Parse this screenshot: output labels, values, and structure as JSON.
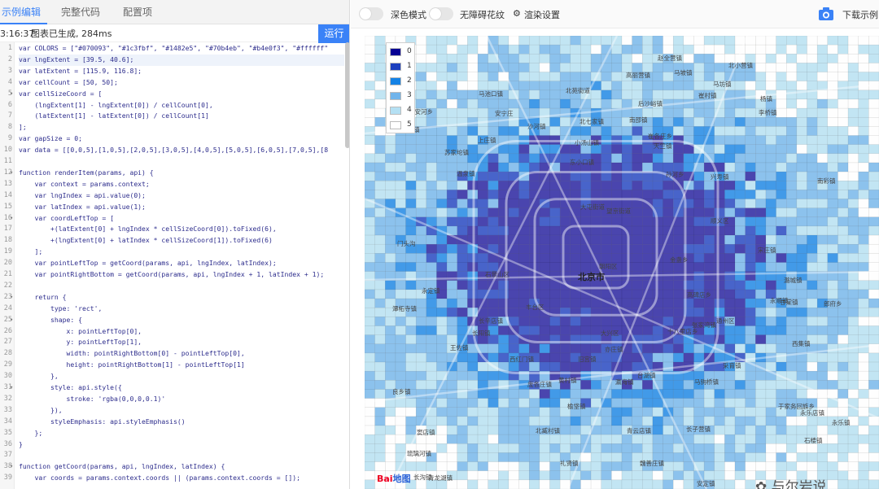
{
  "tabs": [
    "示例编辑",
    "完整代码",
    "配置项"
  ],
  "status": {
    "time": "3:16:37",
    "message": "图表已生成, 284ms"
  },
  "run_label": "运行",
  "code_lines": [
    "var COLORS = [\"#070093\", \"#1c3fbf\", \"#1482e5\", \"#70b4eb\", \"#b4e0f3\", \"#ffffff\"",
    "var lngExtent = [39.5, 40.6];",
    "var latExtent = [115.9, 116.8];",
    "var cellCount = [50, 50];",
    "var cellSizeCoord = [",
    "    (lngExtent[1] - lngExtent[0]) / cellCount[0],",
    "    (latExtent[1] - latExtent[0]) / cellCount[1]",
    "];",
    "var gapSize = 0;",
    "var data = [[0,0,5],[1,0,5],[2,0,5],[3,0,5],[4,0,5],[5,0,5],[6,0,5],[7,0,5],[8",
    "",
    "function renderItem(params, api) {",
    "    var context = params.context;",
    "    var lngIndex = api.value(0);",
    "    var latIndex = api.value(1);",
    "    var coordLeftTop = [",
    "        +(latExtent[0] + lngIndex * cellSizeCoord[0]).toFixed(6),",
    "        +(lngExtent[0] + latIndex * cellSizeCoord[1]).toFixed(6)",
    "    ];",
    "    var pointLeftTop = getCoord(params, api, lngIndex, latIndex);",
    "    var pointRightBottom = getCoord(params, api, lngIndex + 1, latIndex + 1);",
    "",
    "    return {",
    "        type: 'rect',",
    "        shape: {",
    "            x: pointLeftTop[0],",
    "            y: pointLeftTop[1],",
    "            width: pointRightBottom[0] - pointLeftTop[0],",
    "            height: pointRightBottom[1] - pointLeftTop[1]",
    "        },",
    "        style: api.style({",
    "            stroke: 'rgba(0,0,0,0.1)'",
    "        }),",
    "        styleEmphasis: api.styleEmphasis()",
    "    };",
    "}",
    "",
    "function getCoord(params, api, lngIndex, latIndex) {",
    "    var coords = params.context.coords || (params.context.coords = []);"
  ],
  "toolbar": {
    "dark_mode": "深色模式",
    "accessible": "无障碍花纹",
    "render": "渲染设置",
    "download": "下载示例"
  },
  "legend": {
    "labels": [
      "0",
      "1",
      "2",
      "3",
      "4",
      "5"
    ],
    "colors": [
      "#070093",
      "#1c3fbf",
      "#1482e5",
      "#70b4eb",
      "#b4e0f3",
      "#ffffff"
    ]
  },
  "places": [
    {
      "t": "北京市",
      "big": true
    },
    {
      "t": "北七家镇"
    },
    {
      "t": "东小口镇"
    },
    {
      "t": "大屯街道"
    },
    {
      "t": "望京街道"
    },
    {
      "t": "石景山区"
    },
    {
      "t": "丰台区"
    },
    {
      "t": "朝阳区"
    },
    {
      "t": "宋庄镇"
    },
    {
      "t": "长辛店镇"
    },
    {
      "t": "长阳镇"
    },
    {
      "t": "王佐镇"
    },
    {
      "t": "黄村镇"
    },
    {
      "t": "马坊镇"
    },
    {
      "t": "顺义区"
    },
    {
      "t": "西集镇"
    },
    {
      "t": "永乐店镇"
    },
    {
      "t": "窦店镇"
    },
    {
      "t": "良乡镇"
    },
    {
      "t": "于家务回族乡"
    },
    {
      "t": "采育镇"
    },
    {
      "t": "长子营镇"
    },
    {
      "t": "青云店镇"
    },
    {
      "t": "北臧村镇"
    },
    {
      "t": "庞各庄镇"
    },
    {
      "t": "礼贤镇"
    },
    {
      "t": "榆垡镇"
    },
    {
      "t": "琉璃河镇"
    },
    {
      "t": "潞城镇"
    },
    {
      "t": "永顺镇"
    },
    {
      "t": "张家湾镇"
    },
    {
      "t": "台湖镇"
    },
    {
      "t": "马驹桥镇"
    },
    {
      "t": "瀛海镇"
    },
    {
      "t": "亦庄镇"
    },
    {
      "t": "旧宫镇"
    },
    {
      "t": "西红门镇"
    },
    {
      "t": "温泉镇"
    },
    {
      "t": "上庄镇"
    },
    {
      "t": "阳坊镇"
    },
    {
      "t": "北安河乡"
    },
    {
      "t": "苏家坨镇"
    },
    {
      "t": "马池口镇"
    },
    {
      "t": "沙河镇"
    },
    {
      "t": "小汤山镇"
    },
    {
      "t": "南邵镇"
    },
    {
      "t": "崔村镇"
    },
    {
      "t": "兴寿镇"
    },
    {
      "t": "赵全营镇"
    },
    {
      "t": "北小营镇"
    },
    {
      "t": "高丽营镇"
    },
    {
      "t": "杨镇"
    },
    {
      "t": "李桥镇"
    },
    {
      "t": "后沙峪镇"
    },
    {
      "t": "天竺镇"
    },
    {
      "t": "孙河乡"
    },
    {
      "t": "金盏乡"
    },
    {
      "t": "高碑店乡"
    },
    {
      "t": "十八里店乡"
    },
    {
      "t": "甘棠镇"
    },
    {
      "t": "郎府乡"
    },
    {
      "t": "大兴区"
    },
    {
      "t": "通州区"
    },
    {
      "t": "门头沟"
    },
    {
      "t": "永定镇"
    },
    {
      "t": "潭柘寺镇"
    },
    {
      "t": "长沟镇"
    },
    {
      "t": "石楼镇"
    },
    {
      "t": "青龙湖镇"
    },
    {
      "t": "崔各庄乡"
    },
    {
      "t": "北苑街道"
    },
    {
      "t": "马坡镇"
    },
    {
      "t": "南彩镇"
    },
    {
      "t": "安定镇"
    },
    {
      "t": "魏善庄镇"
    },
    {
      "t": "安宁庄"
    },
    {
      "t": "永乐镇"
    }
  ],
  "baidu": {
    "a": "Bai",
    "b": "地图"
  },
  "watermark": "与尔岩说"
}
